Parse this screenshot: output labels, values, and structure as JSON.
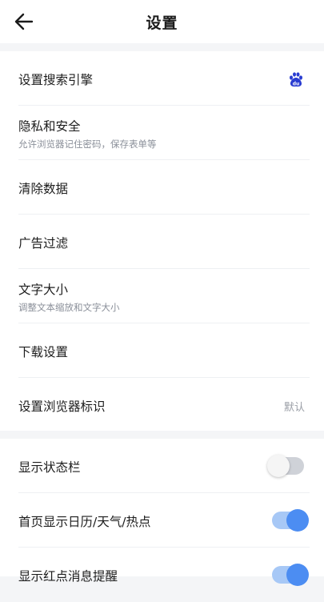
{
  "header": {
    "title": "设置",
    "back_icon": "arrow-left-icon"
  },
  "group1": {
    "search_engine": {
      "label": "设置搜索引擎",
      "icon": "baidu-logo-icon",
      "icon_color": "#2a3dd1"
    },
    "privacy": {
      "label": "隐私和安全",
      "sub": "允许浏览器记住密码，保存表单等"
    },
    "clear_data": {
      "label": "清除数据"
    },
    "ad_filter": {
      "label": "广告过滤"
    },
    "text_size": {
      "label": "文字大小",
      "sub": "调整文本缩放和文字大小"
    },
    "download": {
      "label": "下载设置"
    },
    "browser_ua": {
      "label": "设置浏览器标识",
      "value": "默认"
    }
  },
  "group2": {
    "status_bar": {
      "label": "显示状态栏",
      "enabled": false
    },
    "home_widgets": {
      "label": "首页显示日历/天气/热点",
      "enabled": true
    },
    "red_dot": {
      "label": "显示红点消息提醒",
      "enabled": true
    }
  },
  "colors": {
    "accent": "#4c8df2",
    "accent_track": "#a7c8f6",
    "background": "#f4f5f7"
  }
}
